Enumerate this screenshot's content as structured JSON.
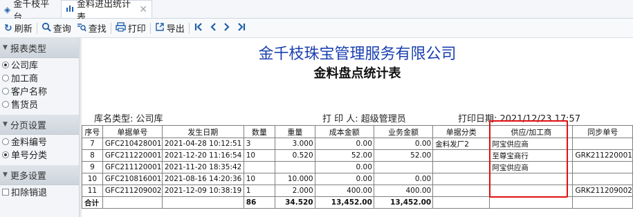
{
  "tabs": [
    {
      "label": "金千枝平台"
    },
    {
      "label": "金料进出统计表",
      "close": "✕"
    }
  ],
  "toolbar": {
    "refresh": "刷新",
    "query": "查询",
    "find": "查找",
    "print": "打印",
    "export": "导出"
  },
  "sidebar": {
    "report_type": {
      "title": "报表类型",
      "options": [
        "公司库",
        "加工商",
        "客户名称",
        "售货员"
      ],
      "selected": "公司库"
    },
    "paging": {
      "title": "分页设置",
      "options": [
        "金料编号",
        "单号分类"
      ],
      "selected": "单号分类"
    },
    "more": {
      "title": "更多设置",
      "checkbox": "扣除销退"
    }
  },
  "report": {
    "company": "金千枝珠宝管理服务有限公司",
    "title": "金料盘点统计表",
    "store_type": "库名类型: 公司库",
    "printer": "打 印 人: 超级管理员",
    "print_date": "打印日期: 2021/12/23 17:57",
    "columns": [
      "序号",
      "单据单号",
      "发生日期",
      "数量",
      "重量",
      "成本金额",
      "业务金额",
      "单据分类",
      "供应/加工商",
      "同步单号"
    ],
    "rows": [
      [
        "7",
        "GFC210428001",
        "2021-04-28 10:12:51",
        "3",
        "3.000",
        "0.00",
        "0.00",
        "金料发厂2",
        "阿宝供应商",
        ""
      ],
      [
        "8",
        "GFC211220001",
        "2021-12-20 11:16:54",
        "10",
        "0.520",
        "52.00",
        "52.00",
        "",
        "至尊宝商行",
        "GRK211220001"
      ],
      [
        "9",
        "GFC211120001",
        "2021-11-20 18:35:42",
        "",
        "",
        "0.00",
        "",
        "",
        "阿宝供应商",
        ""
      ],
      [
        "10",
        "GFC210816001",
        "2021-08-16 14:20:36",
        "10",
        "10.000",
        "0.00",
        "0.00",
        "",
        "",
        ""
      ],
      [
        "11",
        "GFC211209002",
        "2021-12-09 10:38:19",
        "1",
        "2.000",
        "400.00",
        "400.00",
        "",
        "",
        "GRK211209002"
      ]
    ],
    "total": {
      "label": "合计",
      "qty": "86",
      "weight": "34.520",
      "cost": "13,452.00",
      "business": "13,452.00"
    }
  }
}
